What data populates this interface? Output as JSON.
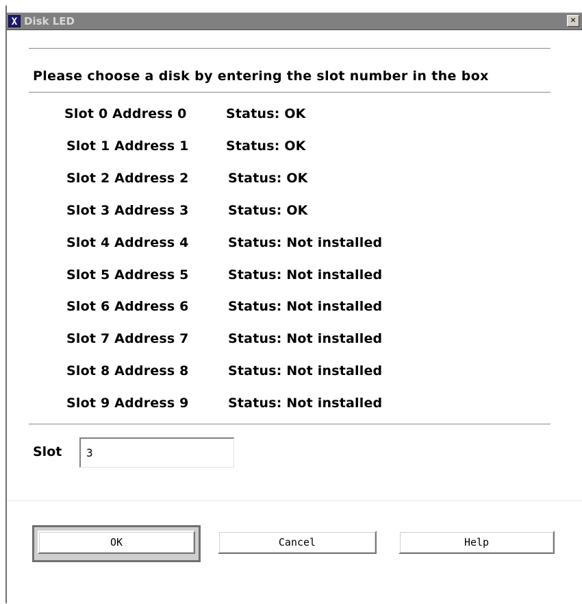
{
  "window": {
    "title": "Disk LED",
    "icon_glyph": "X",
    "close_glyph": "✕"
  },
  "instruction": "Please choose a disk by entering the slot number in the box",
  "slots": [
    {
      "label": "Slot 0 Address 0",
      "status": "Status: OK"
    },
    {
      "label": "Slot 1 Address 1",
      "status": "Status: OK"
    },
    {
      "label": "Slot 2 Address 2",
      "status": "Status: OK"
    },
    {
      "label": "Slot 3 Address 3",
      "status": "Status: OK"
    },
    {
      "label": "Slot 4 Address 4",
      "status": "Status: Not installed"
    },
    {
      "label": "Slot 5 Address 5",
      "status": "Status: Not installed"
    },
    {
      "label": "Slot 6 Address 6",
      "status": "Status: Not installed"
    },
    {
      "label": "Slot 7 Address 7",
      "status": "Status: Not installed"
    },
    {
      "label": "Slot 8 Address 8",
      "status": "Status: Not installed"
    },
    {
      "label": "Slot 9 Address 9",
      "status": "Status: Not installed"
    }
  ],
  "slot_field": {
    "label": "Slot",
    "value": "3"
  },
  "buttons": {
    "ok": "OK",
    "cancel": "Cancel",
    "help": "Help"
  },
  "colors": {
    "titlebar": "#808080",
    "background": "#ffffff",
    "text": "#000000"
  },
  "icons": {
    "window_icon": "x-app-icon",
    "close": "close-icon"
  }
}
